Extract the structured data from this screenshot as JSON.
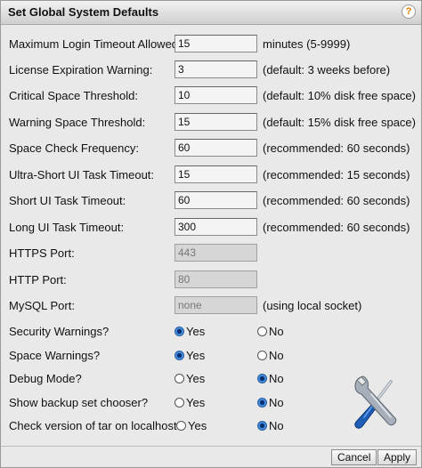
{
  "title": "Set Global System Defaults",
  "help_glyph": "?",
  "text_fields": [
    {
      "label": "Maximum Login Timeout Allowed:",
      "value": "15",
      "hint": "minutes (5-9999)",
      "disabled": false
    },
    {
      "label": "License Expiration Warning:",
      "value": "3",
      "hint": "(default: 3 weeks before)",
      "disabled": false
    },
    {
      "label": "Critical Space Threshold:",
      "value": "10",
      "hint": "(default: 10% disk free space)",
      "disabled": false
    },
    {
      "label": "Warning Space Threshold:",
      "value": "15",
      "hint": "(default: 15% disk free space)",
      "disabled": false
    },
    {
      "label": "Space Check Frequency:",
      "value": "60",
      "hint": "(recommended: 60 seconds)",
      "disabled": false
    },
    {
      "label": "Ultra-Short UI Task Timeout:",
      "value": "15",
      "hint": "(recommended: 15 seconds)",
      "disabled": false
    },
    {
      "label": "Short UI Task Timeout:",
      "value": "60",
      "hint": "(recommended: 60 seconds)",
      "disabled": false
    },
    {
      "label": "Long UI Task Timeout:",
      "value": "300",
      "hint": "(recommended: 60 seconds)",
      "disabled": false
    },
    {
      "label": "HTTPS Port:",
      "value": "443",
      "hint": "",
      "disabled": true
    },
    {
      "label": "HTTP Port:",
      "value": "80",
      "hint": "",
      "disabled": true
    },
    {
      "label": "MySQL Port:",
      "value": "none",
      "hint": "(using local socket)",
      "disabled": true
    }
  ],
  "radio_options": {
    "yes": "Yes",
    "no": "No"
  },
  "radio_fields": [
    {
      "label": "Security Warnings?",
      "selected": "yes"
    },
    {
      "label": "Space Warnings?",
      "selected": "yes"
    },
    {
      "label": "Debug Mode?",
      "selected": "no"
    },
    {
      "label": "Show backup set chooser?",
      "selected": "no"
    },
    {
      "label": "Check version of tar on localhost?",
      "selected": "no"
    }
  ],
  "icon": "tools-icon",
  "buttons": {
    "cancel": "Cancel",
    "apply": "Apply"
  }
}
